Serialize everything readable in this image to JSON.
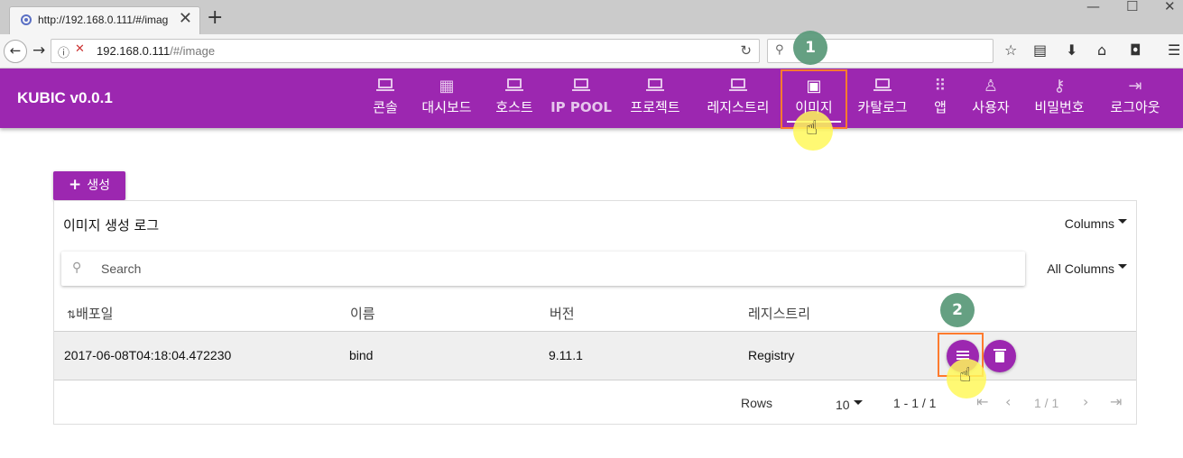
{
  "browser": {
    "tab_title": "http://192.168.0.111/#/imag",
    "url_host": "192.168.0.111",
    "url_path": "/#/image",
    "new_tab": "+",
    "tab_close": "✕",
    "minimize": "—",
    "maximize": "☐",
    "close": "✕"
  },
  "app": {
    "brand": "KUBIC v0.0.1",
    "menu": [
      {
        "label": "콘솔",
        "icon": "laptop-icon"
      },
      {
        "label": "대시보드",
        "icon": "dashboard-icon"
      },
      {
        "label": "호스트",
        "icon": "laptop-icon"
      },
      {
        "label": "IP POOL",
        "icon": "laptop-icon"
      },
      {
        "label": "프로젝트",
        "icon": "laptop-icon"
      },
      {
        "label": "레지스트리",
        "icon": "laptop-icon"
      },
      {
        "label": "이미지",
        "icon": "image-icon",
        "active": true
      },
      {
        "label": "카탈로그",
        "icon": "laptop-icon"
      },
      {
        "label": "앱",
        "icon": "apps-icon"
      },
      {
        "label": "사용자",
        "icon": "person-icon"
      },
      {
        "label": "비밀번호",
        "icon": "key-icon"
      },
      {
        "label": "로그아웃",
        "icon": "logout-icon"
      }
    ],
    "accent": "#9c27b0"
  },
  "steps": {
    "one": "1",
    "two": "2"
  },
  "content": {
    "create_label": "생성",
    "create_plus": "+",
    "table_title": "이미지 생성 로그",
    "columns_label": "Columns",
    "search_placeholder": "Search",
    "all_columns_label": "All Columns",
    "sort_icon": "⇅",
    "headers": [
      "배포일",
      "이름",
      "버전",
      "레지스트리"
    ],
    "rows": [
      {
        "date": "2017-06-08T04:18:04.472230",
        "name": "bind",
        "version": "9.11.1",
        "registry": "Registry"
      }
    ],
    "footer": {
      "rows_label": "Rows",
      "rows_value": "10",
      "range": "1 - 1 / 1",
      "page": "1 / 1"
    }
  }
}
